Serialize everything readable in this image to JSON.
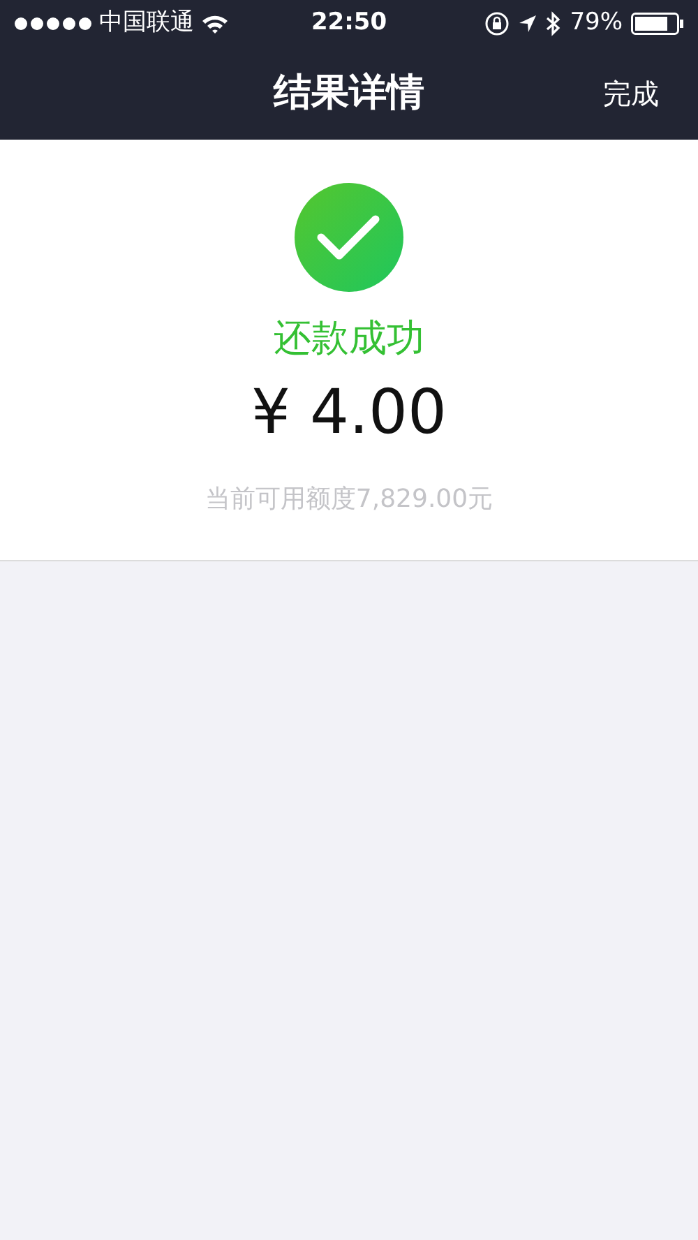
{
  "status_bar": {
    "carrier": "中国联通",
    "time": "22:50",
    "battery": "79%"
  },
  "nav_bar": {
    "title": "结果详情",
    "done": "完成"
  },
  "result": {
    "status": "还款成功",
    "amount": "¥ 4.00",
    "available_credit": "当前可用额度7,829.00元"
  }
}
